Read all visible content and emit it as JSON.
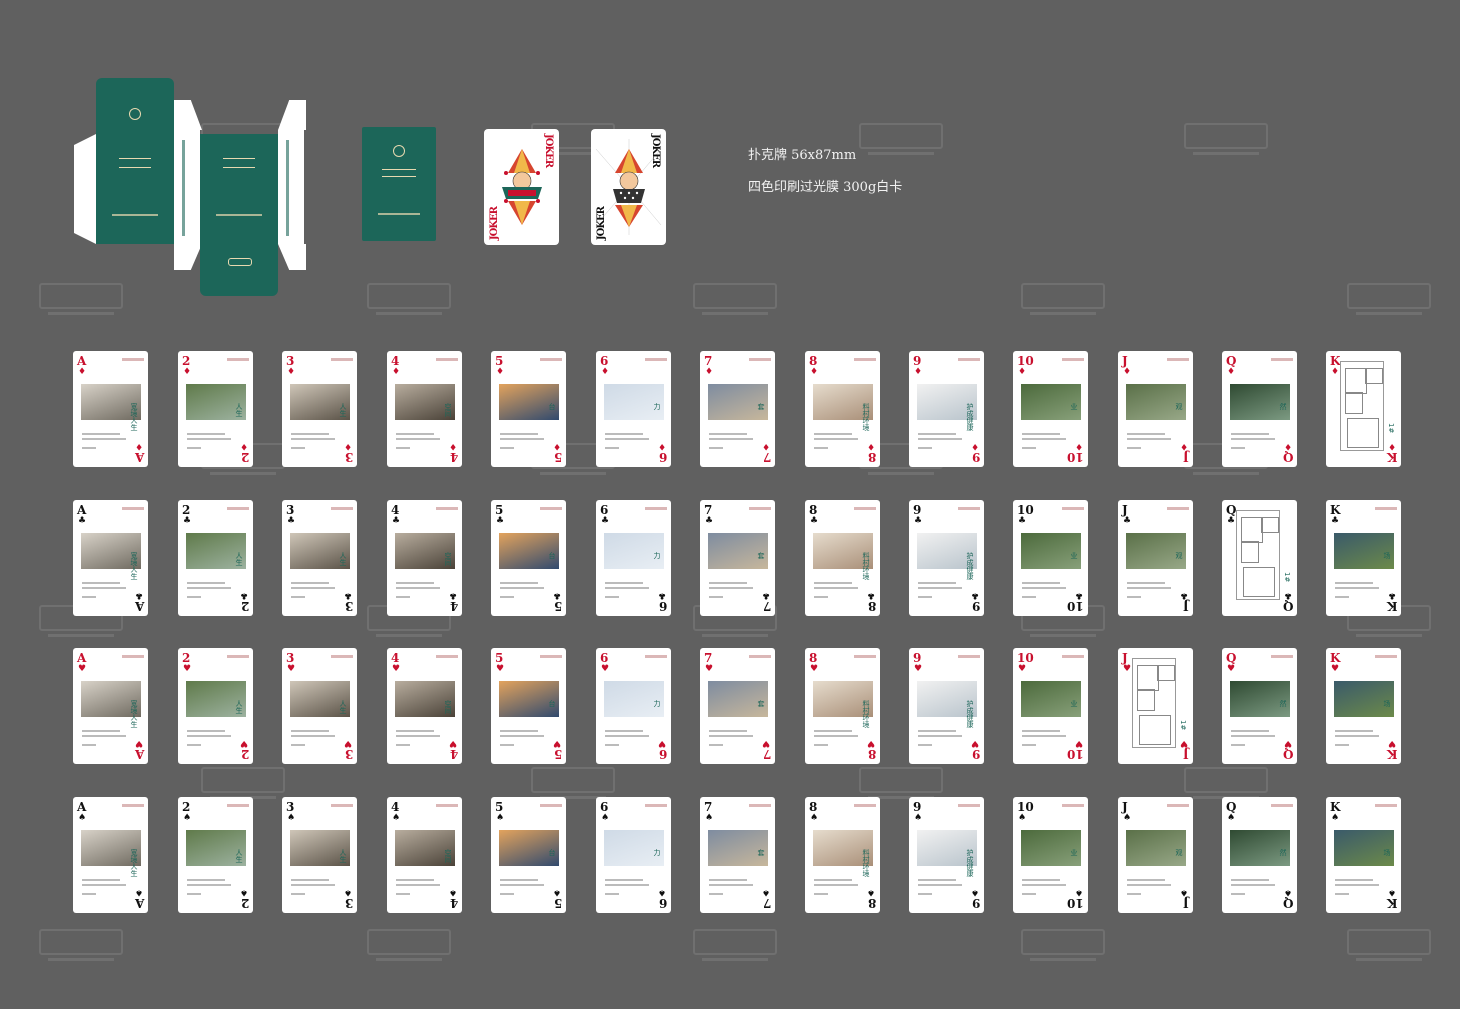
{
  "spec": {
    "line1": "扑克牌   56x87mm",
    "line2": "四色印刷过光膜  300g白卡"
  },
  "joker": {
    "word": "JOKER"
  },
  "colors": {
    "background": "#606060",
    "box_green": "#1c6659",
    "red_suit": "#c8102e",
    "black_suit": "#111111"
  },
  "rows": [
    {
      "suit": "♦",
      "color": "red"
    },
    {
      "suit": "♣",
      "color": "black"
    },
    {
      "suit": "♥",
      "color": "red"
    },
    {
      "suit": "♠",
      "color": "black"
    }
  ],
  "cards": [
    {
      "rank": "A",
      "tag": "宽境人生"
    },
    {
      "rank": "2",
      "tag": "人生"
    },
    {
      "rank": "3",
      "tag": "人生"
    },
    {
      "rank": "4",
      "tag": "空间"
    },
    {
      "rank": "5",
      "tag": "台"
    },
    {
      "rank": "6",
      "tag": "力"
    },
    {
      "rank": "7",
      "tag": "套"
    },
    {
      "rank": "8",
      "tag": "料村环境"
    },
    {
      "rank": "9",
      "tag": "护成健康"
    },
    {
      "rank": "10",
      "tag": "业"
    },
    {
      "rank": "J",
      "tag": "观"
    },
    {
      "rank": "Q",
      "tag": "然"
    },
    {
      "rank": "K",
      "tag": "场"
    }
  ],
  "plan_cards": [
    {
      "row": 0,
      "col": 12,
      "label": "1#"
    },
    {
      "row": 1,
      "col": 11,
      "label": "1#"
    },
    {
      "row": 2,
      "col": 10,
      "label": "1#"
    }
  ]
}
